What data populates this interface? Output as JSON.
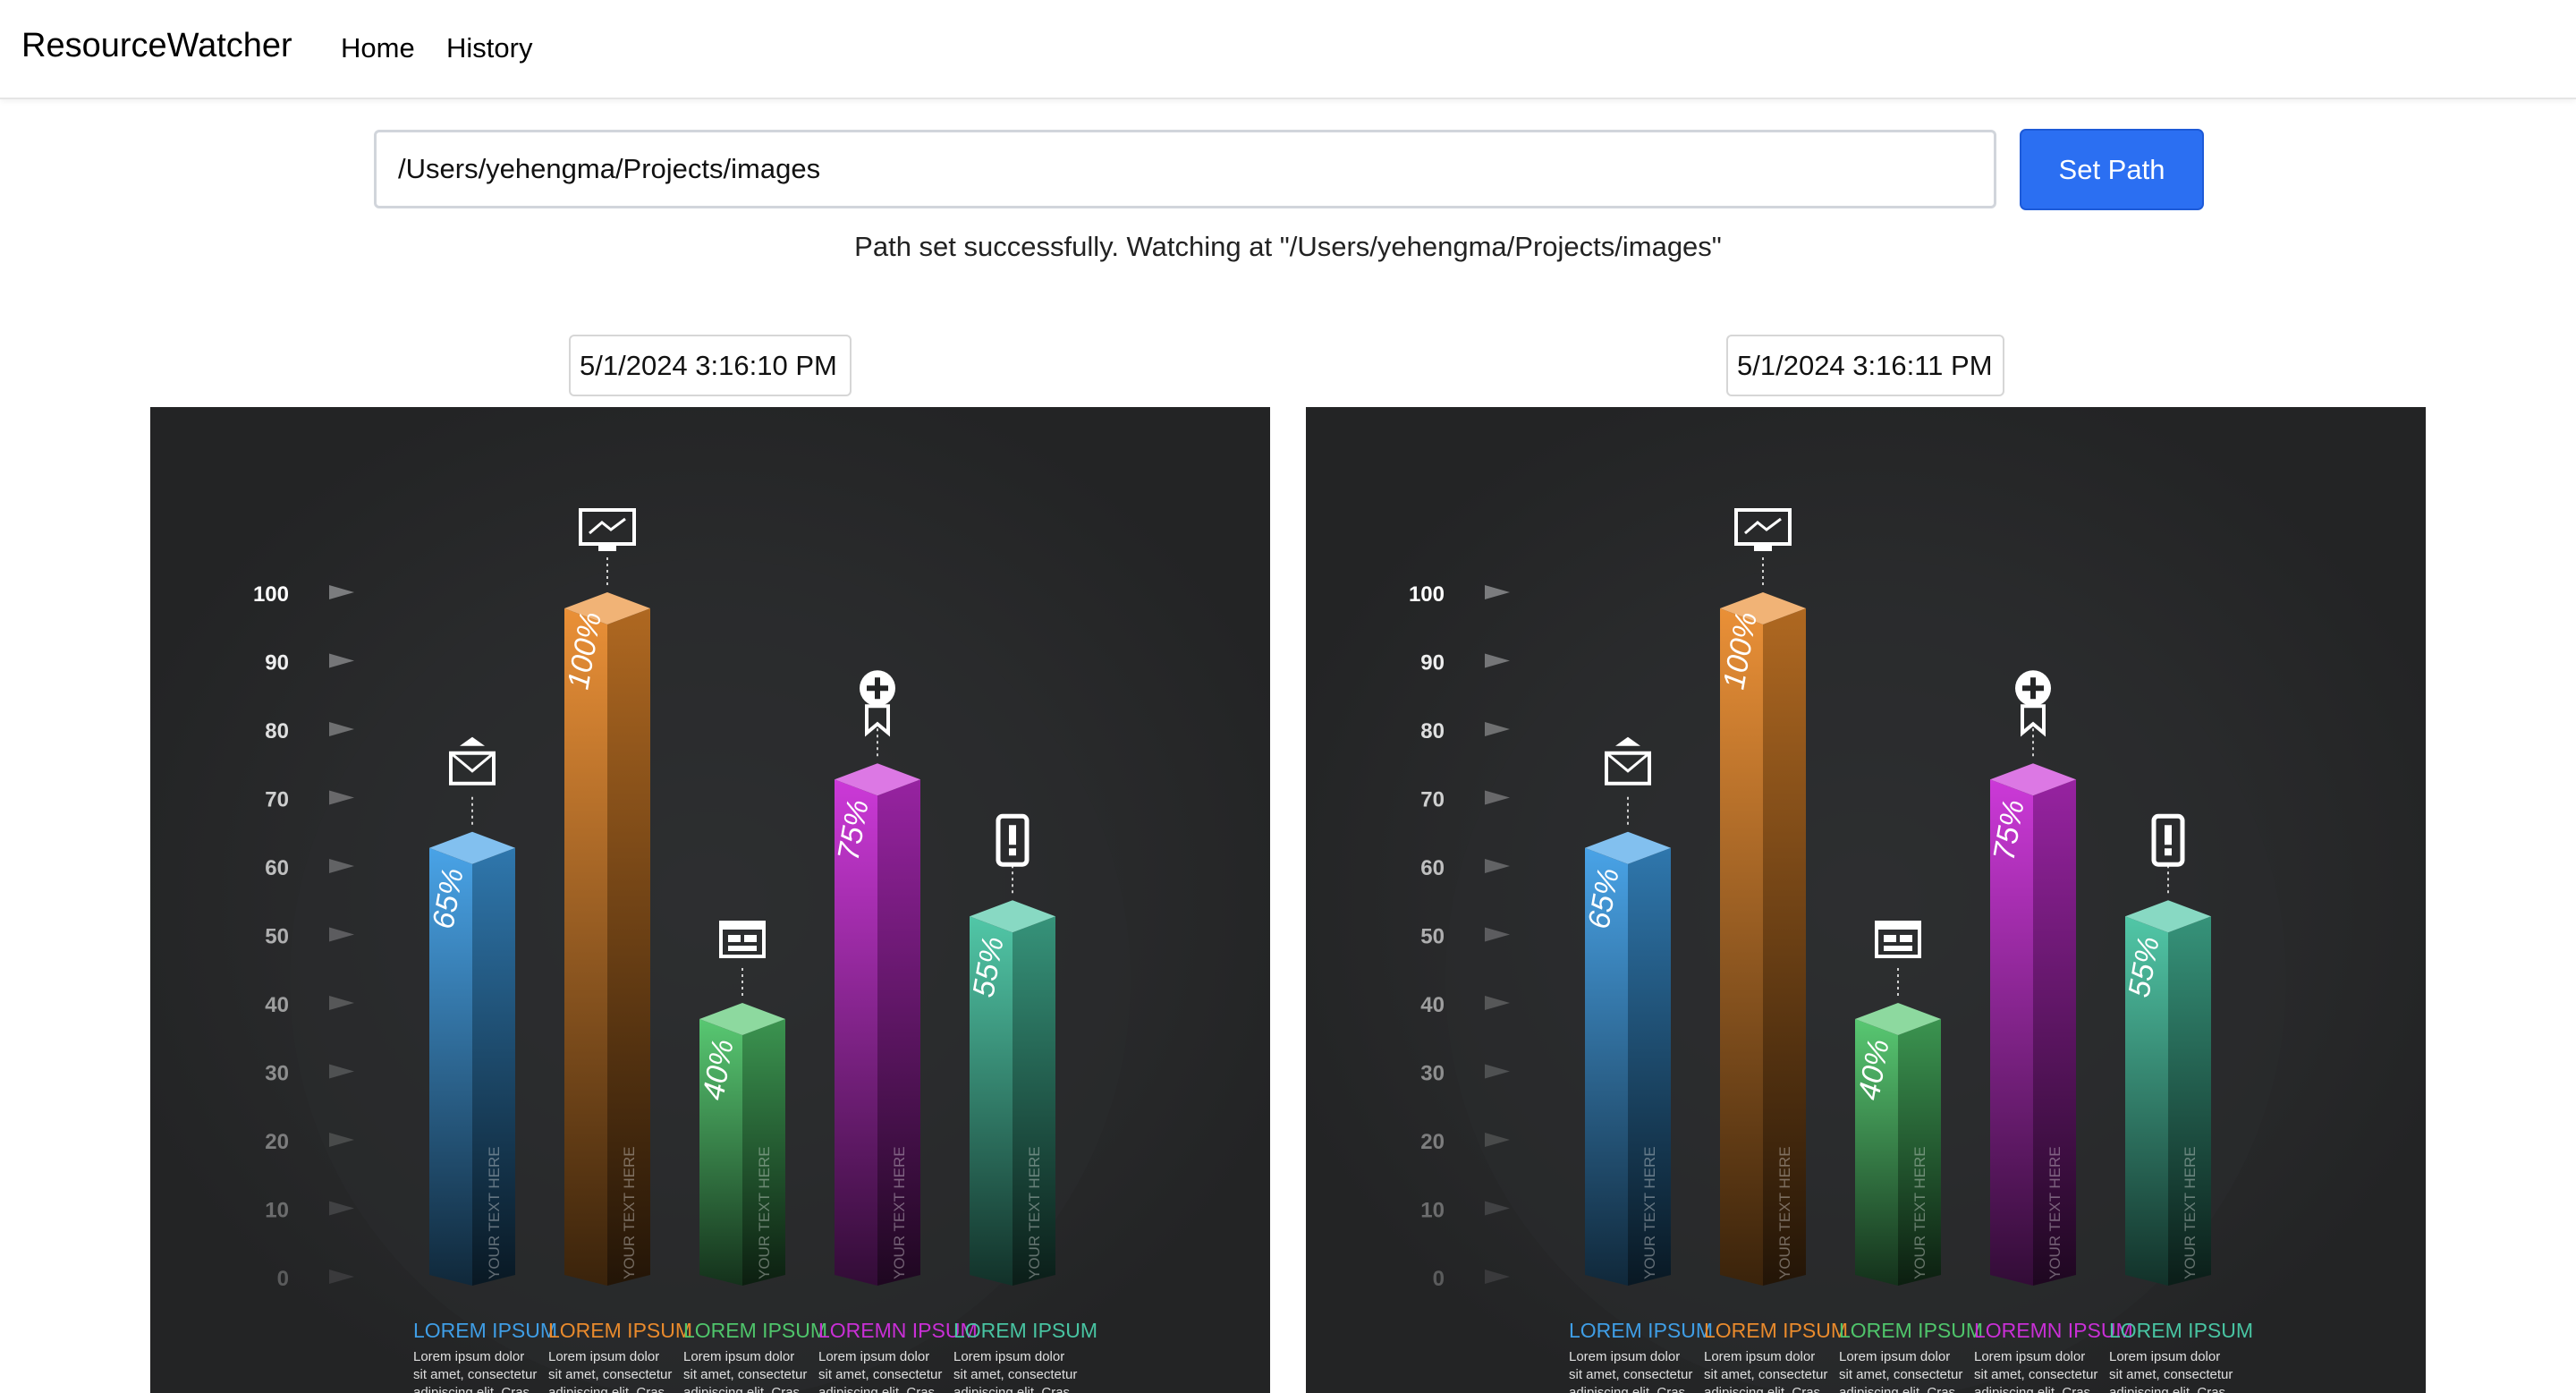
{
  "navbar": {
    "brand": "ResourceWatcher",
    "links": [
      "Home",
      "History"
    ]
  },
  "path_form": {
    "value": "/Users/yehengma/Projects/images",
    "button_label": "Set Path"
  },
  "status_message": "Path set successfully. Watching at \"/Users/yehengma/Projects/images\"",
  "snapshots": [
    {
      "timestamp": "5/1/2024 3:16:10 PM"
    },
    {
      "timestamp": "5/1/2024 3:16:11 PM"
    }
  ],
  "colors": {
    "primary_button": "#2b6ff2",
    "panel_background": "#232425"
  },
  "chart_data": {
    "type": "bar",
    "y_ticks": [
      "100",
      "90",
      "80",
      "70",
      "60",
      "50",
      "40",
      "30",
      "20",
      "10",
      "0"
    ],
    "ylim": [
      0,
      100
    ],
    "categories": [
      "LOREM IPSUM",
      "LOREM IPSUM",
      "LOREM IPSUM",
      "LOREMN IPSUM",
      "LOREM IPSUM"
    ],
    "values": [
      65,
      100,
      40,
      75,
      55
    ],
    "value_labels": [
      "65%",
      "100%",
      "40%",
      "75%",
      "55%"
    ],
    "bar_text": "YOUR TEXT HERE",
    "desc_lines": [
      "Lorem ipsum dolor",
      "sit amet, consectetur",
      "adipiscing elit. Cras"
    ],
    "icons": [
      "envelope-icon",
      "monitor-chart-icon",
      "window-layout-icon",
      "medal-plus-icon",
      "phone-alert-icon"
    ],
    "bar_colors": [
      "#3f9ee6",
      "#e98a2c",
      "#4fc56b",
      "#c92fd6",
      "#48c4a2"
    ]
  }
}
